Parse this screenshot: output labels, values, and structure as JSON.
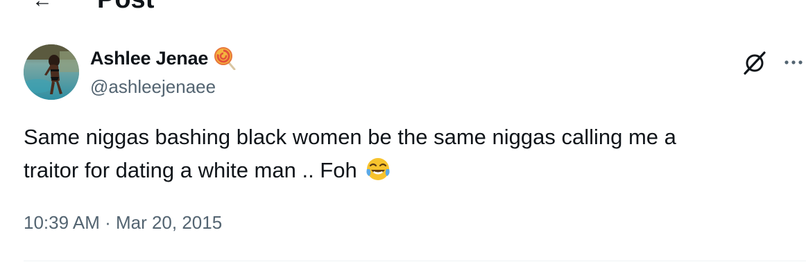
{
  "header": {
    "back_label": "←",
    "title": "Post"
  },
  "tweet": {
    "author": {
      "display_name": "Ashlee Jenae",
      "handle": "@ashleejenaee",
      "name_emoji_icon": "lollipop-icon",
      "avatar_icon": "avatar-photo"
    },
    "text_line_1": "Same niggas bashing black women be the same niggas calling me a",
    "text_line_2": "traitor for dating a white man .. Foh",
    "text_emoji_icon": "face-with-tears-of-joy-icon",
    "time": "10:39 AM",
    "separator": " · ",
    "date": "Mar 20, 2015"
  },
  "actions": {
    "grok_icon": "grok-icon",
    "more_icon": "more-icon"
  },
  "colors": {
    "text_primary": "#0f1419",
    "text_secondary": "#536471",
    "divider": "#eff3f4",
    "emoji_yellow": "#f7c32e",
    "tear_blue": "#5aa9e6",
    "lollipop_orange": "#e8763a"
  }
}
